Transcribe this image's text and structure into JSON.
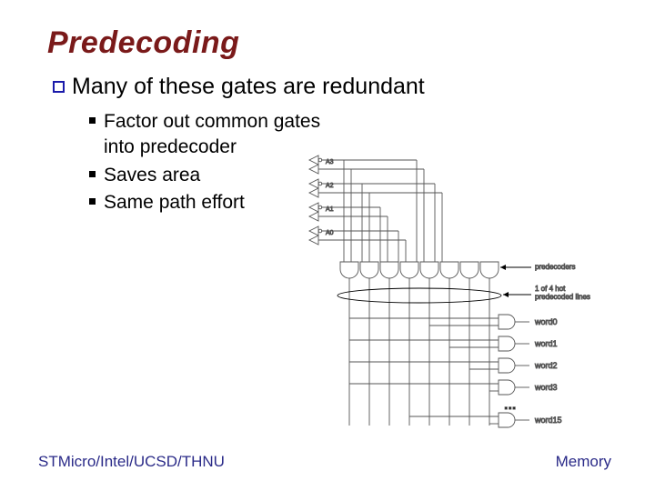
{
  "title": "Predecoding",
  "bullet1": "Many of these gates are redundant",
  "sub1": "Factor out common gates into predecoder",
  "sub2": "Saves area",
  "sub3": "Same path effort",
  "footer_left": "STMicro/Intel/UCSD/THNU",
  "footer_right": "Memory",
  "diag": {
    "a3": "A3",
    "a2": "A2",
    "a1": "A1",
    "a0": "A0",
    "predecoders": "predecoders",
    "hot_lines_1": "1 of 4 hot",
    "hot_lines_2": "predecoded lines",
    "word0": "word0",
    "word1": "word1",
    "word2": "word2",
    "word3": "word3",
    "word15": "word15",
    "dots": "..."
  }
}
